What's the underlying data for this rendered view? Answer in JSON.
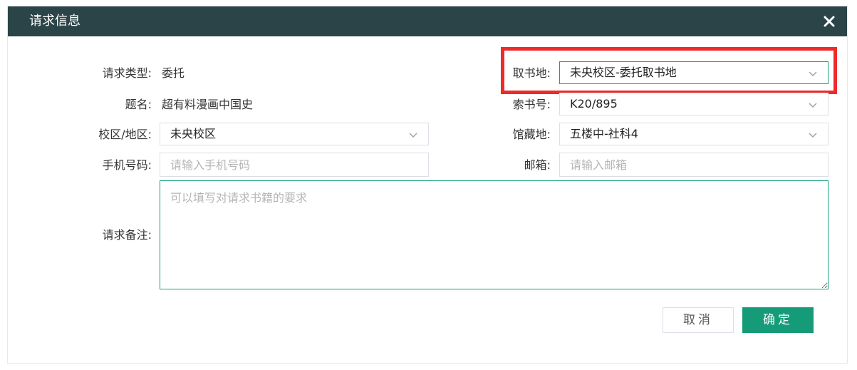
{
  "dialog": {
    "title": "请求信息",
    "close_icon": "close-icon"
  },
  "form": {
    "request_type": {
      "label": "请求类型:",
      "value": "委托"
    },
    "title_field": {
      "label": "题名:",
      "value": "超有料漫画中国史"
    },
    "campus": {
      "label": "校区/地区:",
      "value": "未央校区"
    },
    "phone": {
      "label": "手机号码:",
      "placeholder": "请输入手机号码",
      "value": ""
    },
    "pickup": {
      "label": "取书地:",
      "value": "未央校区-委托取书地"
    },
    "call_number": {
      "label": "索书号:",
      "value": "K20/895"
    },
    "location": {
      "label": "馆藏地:",
      "value": "五楼中-社科4"
    },
    "email": {
      "label": "邮箱:",
      "placeholder": "请输入邮箱",
      "value": ""
    },
    "remark": {
      "label": "请求备注:",
      "placeholder": "可以填写对请求书籍的要求",
      "value": ""
    }
  },
  "actions": {
    "cancel_label": "取消",
    "confirm_label": "确定"
  },
  "colors": {
    "header_bg": "#2b4447",
    "accent": "#169b78",
    "highlight": "#ee2a2a"
  }
}
